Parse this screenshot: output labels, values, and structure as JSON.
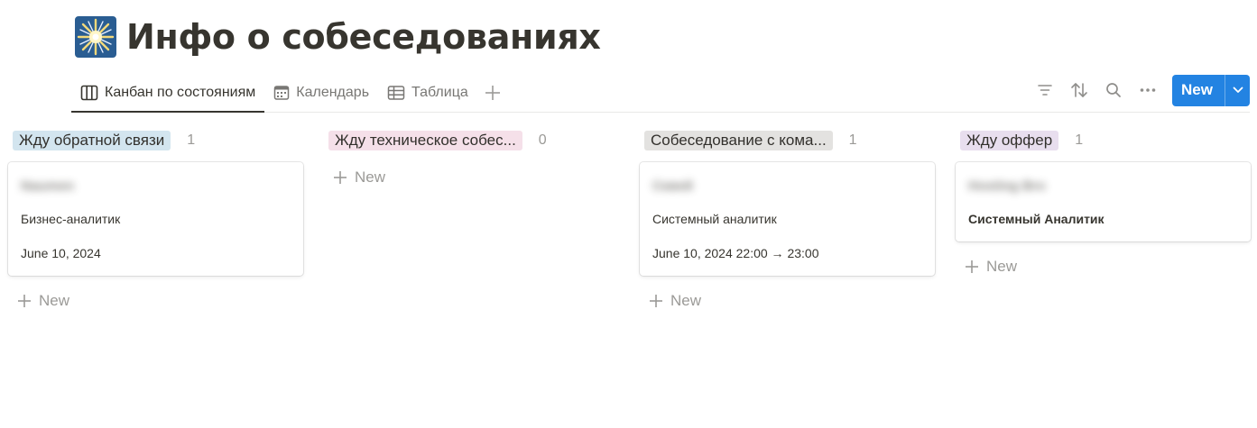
{
  "page": {
    "title": "Инфо о собеседованиях",
    "icon": "sunburst-icon"
  },
  "tabs": [
    {
      "label": "Канбан по состояниям",
      "icon": "board-icon",
      "active": true
    },
    {
      "label": "Календарь",
      "icon": "calendar-icon",
      "active": false
    },
    {
      "label": "Таблица",
      "icon": "table-icon",
      "active": false
    }
  ],
  "toolbar": {
    "new_label": "New",
    "icons": [
      "filter-icon",
      "sort-icon",
      "search-icon",
      "more-icon",
      "chevron-down-icon"
    ]
  },
  "colors": {
    "accent": "#2383e2"
  },
  "columns": [
    {
      "title": "Жду обратной связи",
      "count": "1",
      "tag_color": "#d3e5ef",
      "cards": [
        {
          "name": "Naumen",
          "role": "Бизнес-аналитик",
          "date": "June 10, 2024"
        }
      ]
    },
    {
      "title": "Жду техническое собес...",
      "count": "0",
      "tag_color": "#f5e0e9",
      "cards": []
    },
    {
      "title": "Собеседование с кома...",
      "count": "1",
      "tag_color": "#e3e2e0",
      "cards": [
        {
          "name": "Сквей",
          "role": "Системный аналитик",
          "date": "June 10, 2024 22:00 → 23:00"
        }
      ]
    },
    {
      "title": "Жду оффер",
      "count": "1",
      "tag_color": "#e8deee",
      "cards": [
        {
          "name": "Hosting Bro",
          "role": "Системный Аналитик"
        }
      ]
    }
  ],
  "add_new_label": "New"
}
